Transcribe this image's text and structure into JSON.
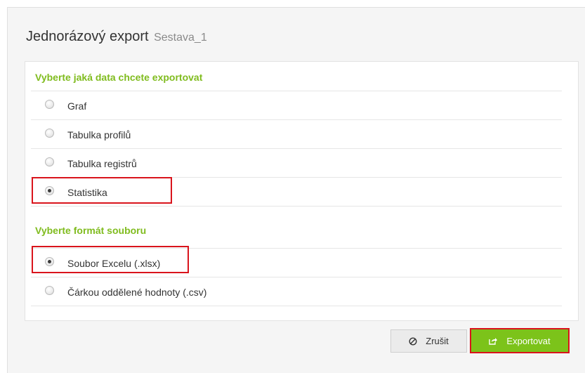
{
  "dialog": {
    "title": "Jednorázový export",
    "subtitle": "Sestava_1"
  },
  "data_section": {
    "heading": "Vyberte jaká data chcete exportovat",
    "options": [
      {
        "label": "Graf",
        "selected": false
      },
      {
        "label": "Tabulka profilů",
        "selected": false
      },
      {
        "label": "Tabulka registrů",
        "selected": false
      },
      {
        "label": "Statistika",
        "selected": true
      }
    ]
  },
  "format_section": {
    "heading": "Vyberte formát souboru",
    "options": [
      {
        "label": "Soubor Excelu (.xlsx)",
        "selected": true
      },
      {
        "label": "Čárkou oddělené hodnoty (.csv)",
        "selected": false
      }
    ]
  },
  "footer": {
    "cancel_label": "Zrušit",
    "cancel_icon": "cancel-circle-icon",
    "export_label": "Exportovat",
    "export_icon": "export-share-icon"
  },
  "colors": {
    "accent_green": "#80bc1f",
    "button_green": "#7cc31a",
    "highlight_red": "#d9141c"
  }
}
